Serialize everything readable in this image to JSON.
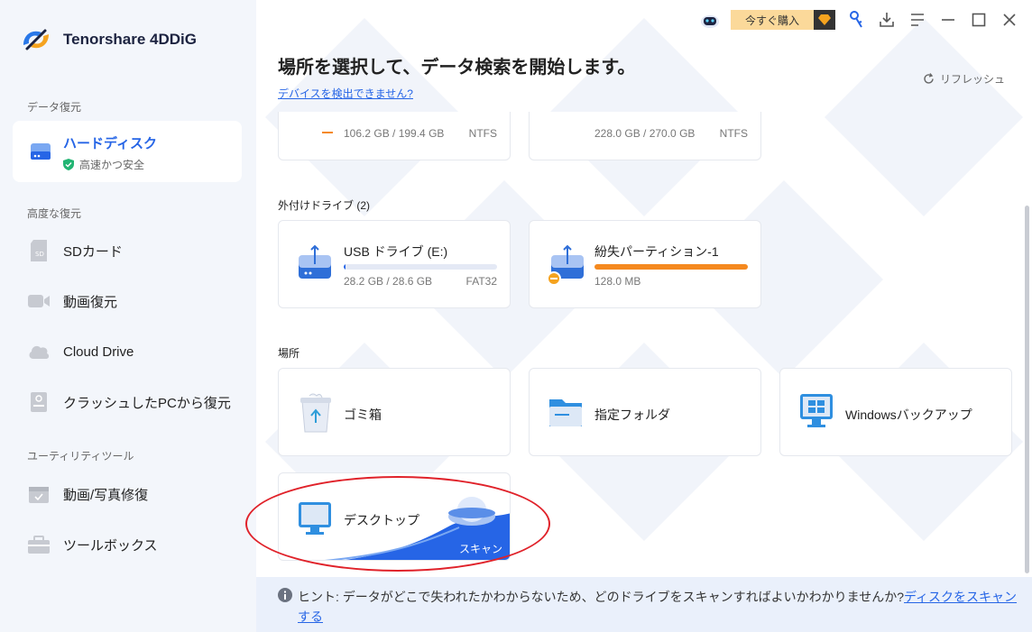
{
  "app": {
    "name": "Tenorshare 4DDiG"
  },
  "sidebar": {
    "sections": {
      "recovery": "データ復元",
      "advanced": "高度な復元",
      "utility": "ユーティリティツール"
    },
    "active": {
      "label": "ハードディスク",
      "sub": "高速かつ安全"
    },
    "items": [
      {
        "label": "SDカード"
      },
      {
        "label": "動画復元"
      },
      {
        "label": "Cloud Drive"
      },
      {
        "label": "クラッシュしたPCから復元"
      },
      {
        "label": "動画/写真修復"
      },
      {
        "label": "ツールボックス"
      }
    ]
  },
  "topbar": {
    "buy_label": "今すぐ購入"
  },
  "main": {
    "title": "場所を選択して、データ検索を開始します。",
    "detect_link": "デバイスを検出できません?",
    "refresh": "リフレッシュ"
  },
  "partial_drives": [
    {
      "size": "106.2 GB / 199.4 GB",
      "fs": "NTFS"
    },
    {
      "size": "228.0 GB / 270.0 GB",
      "fs": "NTFS"
    }
  ],
  "external": {
    "title": "外付けドライブ (2)",
    "drives": [
      {
        "name": "USB ドライブ (E:)",
        "size": "28.2 GB / 28.6 GB",
        "fs": "FAT32",
        "used_fraction": 0.01
      },
      {
        "name": "紛失パーティション-1",
        "size": "128.0 MB",
        "used_fraction": 1.0
      }
    ]
  },
  "locations": {
    "title": "場所",
    "items": [
      {
        "name": "ゴミ箱"
      },
      {
        "name": "指定フォルダ"
      },
      {
        "name": "Windowsバックアップ"
      },
      {
        "name": "デスクトップ",
        "action": "スキャン"
      }
    ]
  },
  "hint": {
    "text": "ヒント: データがどこで失われたかわからないため、どのドライブをスキャンすればよいかわかりませんか?",
    "link": "ディスクをスキャンする"
  },
  "colors": {
    "accent": "#2665e6",
    "orange": "#f5891f",
    "highlight": "#e0222a"
  }
}
